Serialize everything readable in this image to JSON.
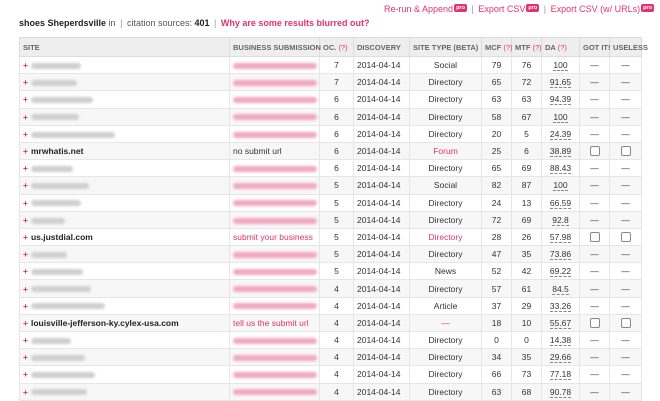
{
  "toplinks": {
    "rerun": "Re-run & Append",
    "export_csv": "Export CSV",
    "export_csv_urls": "Export CSV (w/ URLs)",
    "pro_badge": "pro",
    "sep": "|"
  },
  "summary": {
    "query": "shoes Sheperdsville",
    "in_text": "in",
    "citation_label": "citation sources:",
    "count": "401",
    "blur_link": "Why are some results blurred out?",
    "sep": "|"
  },
  "columns": {
    "site": "SITE",
    "business_submission": "BUSINESS SUBMISSION",
    "oc": "OC.",
    "discovery": "DISCOVERY",
    "site_type": "SITE TYPE (BETA)",
    "mcf": "MCF",
    "mtf": "MTF",
    "da": "DA",
    "got_it": "GOT IT!",
    "useless": "USELESS",
    "help": "(?)"
  },
  "rows": [
    {
      "site": "",
      "blurred": true,
      "sub": "",
      "sub_blurred": true,
      "oc": "7",
      "date": "2014-04-14",
      "type": "Social",
      "mcf": "79",
      "mtf": "76",
      "da": "100",
      "got": "—",
      "useless": "—"
    },
    {
      "site": "",
      "blurred": true,
      "sub": "",
      "sub_blurred": true,
      "oc": "7",
      "date": "2014-04-14",
      "type": "Directory",
      "mcf": "65",
      "mtf": "72",
      "da": "91.65",
      "got": "—",
      "useless": "—"
    },
    {
      "site": "",
      "blurred": true,
      "sub": "",
      "sub_blurred": true,
      "oc": "6",
      "date": "2014-04-14",
      "type": "Directory",
      "mcf": "63",
      "mtf": "63",
      "da": "94.39",
      "got": "—",
      "useless": "—"
    },
    {
      "site": "",
      "blurred": true,
      "sub": "",
      "sub_blurred": true,
      "oc": "6",
      "date": "2014-04-14",
      "type": "Directory",
      "mcf": "58",
      "mtf": "67",
      "da": "100",
      "got": "—",
      "useless": "—"
    },
    {
      "site": "",
      "blurred": true,
      "sub": "",
      "sub_blurred": true,
      "oc": "6",
      "date": "2014-04-14",
      "type": "Directory",
      "mcf": "20",
      "mtf": "5",
      "da": "24.39",
      "got": "—",
      "useless": "—"
    },
    {
      "site": "mrwhatis.net",
      "blurred": false,
      "sub": "no submit url",
      "sub_blurred": false,
      "sub_pink": false,
      "oc": "6",
      "date": "2014-04-14",
      "type": "Forum",
      "type_pink": true,
      "mcf": "25",
      "mtf": "6",
      "da": "38.89",
      "got": "checkbox",
      "useless": "checkbox"
    },
    {
      "site": "",
      "blurred": true,
      "sub": "",
      "sub_blurred": true,
      "oc": "6",
      "date": "2014-04-14",
      "type": "Directory",
      "mcf": "65",
      "mtf": "69",
      "da": "88.43",
      "got": "—",
      "useless": "—"
    },
    {
      "site": "",
      "blurred": true,
      "sub": "",
      "sub_blurred": true,
      "oc": "5",
      "date": "2014-04-14",
      "type": "Social",
      "mcf": "82",
      "mtf": "87",
      "da": "100",
      "got": "—",
      "useless": "—"
    },
    {
      "site": "",
      "blurred": true,
      "sub": "",
      "sub_blurred": true,
      "oc": "5",
      "date": "2014-04-14",
      "type": "Directory",
      "mcf": "24",
      "mtf": "13",
      "da": "66.59",
      "got": "—",
      "useless": "—"
    },
    {
      "site": "",
      "blurred": true,
      "sub": "",
      "sub_blurred": true,
      "oc": "5",
      "date": "2014-04-14",
      "type": "Directory",
      "mcf": "72",
      "mtf": "69",
      "da": "92.8",
      "got": "—",
      "useless": "—"
    },
    {
      "site": "us.justdial.com",
      "blurred": false,
      "sub": "submit your business",
      "sub_blurred": false,
      "sub_pink": true,
      "oc": "5",
      "date": "2014-04-14",
      "type": "Directory",
      "type_pink": true,
      "mcf": "28",
      "mtf": "26",
      "da": "57.98",
      "got": "checkbox",
      "useless": "checkbox"
    },
    {
      "site": "",
      "blurred": true,
      "sub": "",
      "sub_blurred": true,
      "oc": "5",
      "date": "2014-04-14",
      "type": "Directory",
      "mcf": "47",
      "mtf": "35",
      "da": "73.86",
      "got": "—",
      "useless": "—"
    },
    {
      "site": "",
      "blurred": true,
      "sub": "",
      "sub_blurred": true,
      "oc": "5",
      "date": "2014-04-14",
      "type": "News",
      "mcf": "52",
      "mtf": "42",
      "da": "69.22",
      "got": "—",
      "useless": "—"
    },
    {
      "site": "",
      "blurred": true,
      "sub": "",
      "sub_blurred": true,
      "oc": "4",
      "date": "2014-04-14",
      "type": "Directory",
      "mcf": "57",
      "mtf": "61",
      "da": "84.5",
      "got": "—",
      "useless": "—"
    },
    {
      "site": "",
      "blurred": true,
      "sub": "",
      "sub_blurred": true,
      "oc": "4",
      "date": "2014-04-14",
      "type": "Article",
      "mcf": "37",
      "mtf": "29",
      "da": "33.26",
      "got": "—",
      "useless": "—"
    },
    {
      "site": "louisville-jefferson-ky.cylex-usa.com",
      "blurred": false,
      "sub": "tell us the submit url",
      "sub_blurred": false,
      "sub_pink": true,
      "oc": "4",
      "date": "2014-04-14",
      "type": "—",
      "type_pink": true,
      "mcf": "18",
      "mtf": "10",
      "da": "55.67",
      "got": "checkbox",
      "useless": "checkbox"
    },
    {
      "site": "",
      "blurred": true,
      "sub": "",
      "sub_blurred": true,
      "oc": "4",
      "date": "2014-04-14",
      "type": "Directory",
      "mcf": "0",
      "mtf": "0",
      "da": "14.38",
      "got": "—",
      "useless": "—"
    },
    {
      "site": "",
      "blurred": true,
      "sub": "",
      "sub_blurred": true,
      "oc": "4",
      "date": "2014-04-14",
      "type": "Directory",
      "mcf": "34",
      "mtf": "35",
      "da": "29.66",
      "got": "—",
      "useless": "—"
    },
    {
      "site": "",
      "blurred": true,
      "sub": "",
      "sub_blurred": true,
      "oc": "4",
      "date": "2014-04-14",
      "type": "Directory",
      "mcf": "66",
      "mtf": "73",
      "da": "77.18",
      "got": "—",
      "useless": "—"
    },
    {
      "site": "",
      "blurred": true,
      "sub": "",
      "sub_blurred": true,
      "oc": "4",
      "date": "2014-04-14",
      "type": "Directory",
      "mcf": "63",
      "mtf": "68",
      "da": "90.78",
      "got": "—",
      "useless": "—"
    }
  ],
  "colors": {
    "accent": "#e0336f",
    "header_bg": "#eeeeee",
    "stripe": "#f7f7f7"
  },
  "icons": {
    "plus": "plus-icon",
    "checkbox": "checkbox-icon"
  }
}
